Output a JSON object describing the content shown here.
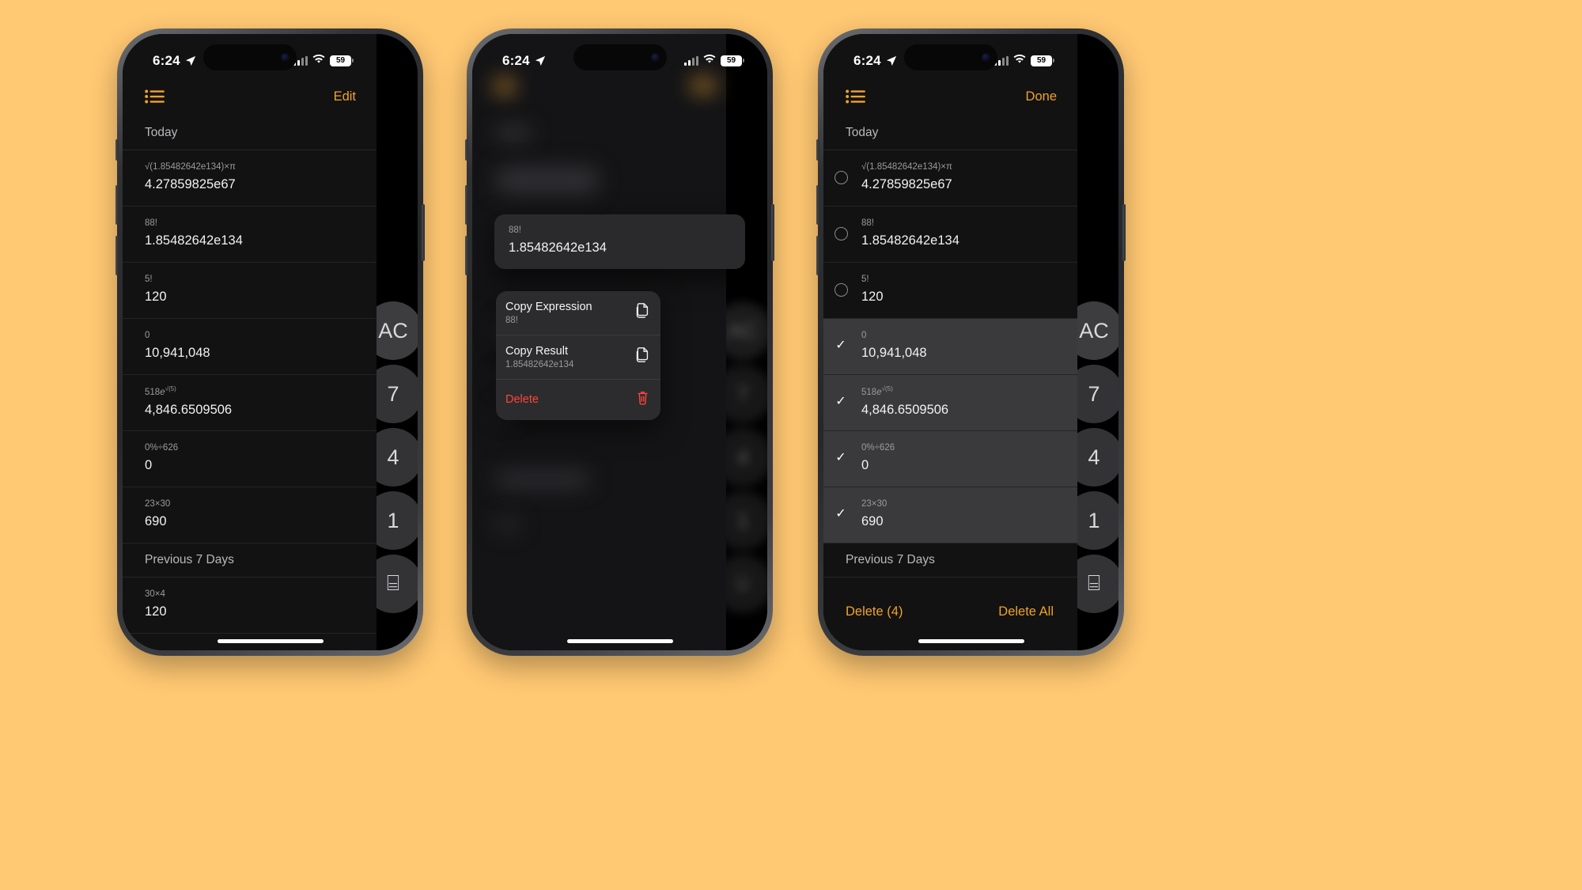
{
  "background_color": "#ffc873",
  "accent_color": "#f0a32b",
  "danger_color": "#ff453a",
  "status_bar": {
    "time": "6:24",
    "location_icon": "location-arrow-icon",
    "signal_icon": "cellular-signal-icon",
    "wifi_icon": "wifi-icon",
    "battery_level": "59"
  },
  "nav": {
    "list_icon": "history-list-icon",
    "edit_label": "Edit",
    "done_label": "Done"
  },
  "sections": {
    "today": "Today",
    "previous_7_days": "Previous 7 Days"
  },
  "history": [
    {
      "expression": "√(1.85482642e134)×π",
      "result": "4.27859825e67",
      "selected": false
    },
    {
      "expression": "88!",
      "result": "1.85482642e134",
      "selected": false
    },
    {
      "expression": "5!",
      "result": "120",
      "selected": false
    },
    {
      "expression": "0",
      "result": "10,941,048",
      "selected": true
    },
    {
      "expression": "518e√(5)",
      "expression_html": "518<span class=\"it\">e</span><sup>√(5)</sup>",
      "result": "4,846.6509506",
      "selected": true
    },
    {
      "expression": "0%÷626",
      "result": "0",
      "selected": true
    },
    {
      "expression": "23×30",
      "result": "690",
      "selected": true
    }
  ],
  "history_previous": [
    {
      "expression": "30×4",
      "result": "120",
      "selected": false
    }
  ],
  "context_menu": {
    "card": {
      "expression": "88!",
      "result": "1.85482642e134"
    },
    "items": [
      {
        "title": "Copy Expression",
        "subtitle": "88!",
        "icon": "copy-icon",
        "danger": false
      },
      {
        "title": "Copy Result",
        "subtitle": "1.85482642e134",
        "icon": "copy-icon",
        "danger": false
      },
      {
        "title": "Delete",
        "subtitle": "",
        "icon": "trash-icon",
        "danger": true
      }
    ]
  },
  "bottom_toolbar": {
    "delete_selected": "Delete (4)",
    "delete_all": "Delete All"
  },
  "keypad": {
    "keys": [
      "AC",
      "7",
      "4",
      "1",
      "⌸"
    ]
  }
}
